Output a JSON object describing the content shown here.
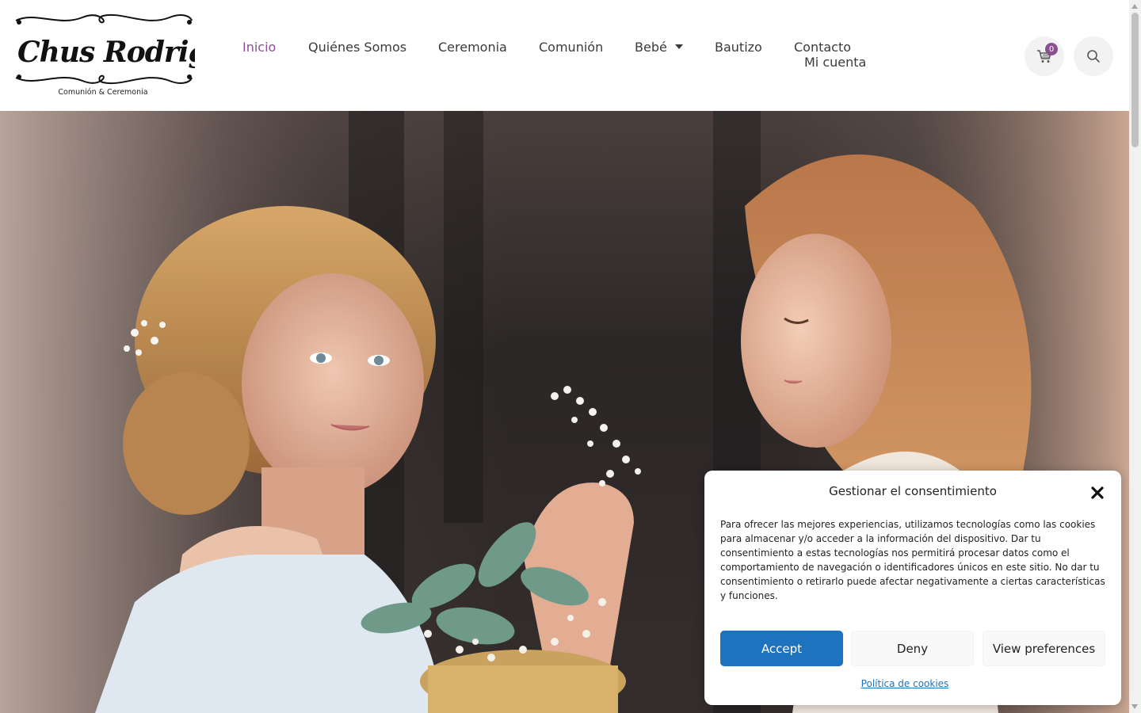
{
  "brand": {
    "logo_script": "Chus Rodriguez",
    "logo_subtitle": "Comunión & Ceremonia"
  },
  "nav": {
    "items": [
      {
        "label": "Inicio",
        "active": true
      },
      {
        "label": "Quiénes Somos"
      },
      {
        "label": "Ceremonia"
      },
      {
        "label": "Comunión"
      },
      {
        "label": "Bebé",
        "has_dropdown": true
      },
      {
        "label": "Bautizo"
      },
      {
        "label": "Contacto"
      },
      {
        "label": "Mi cuenta"
      }
    ]
  },
  "header_actions": {
    "cart_icon": "cart-icon",
    "cart_count": "0",
    "search_icon": "search-icon"
  },
  "colors": {
    "accent": "#8a4f8f",
    "button_primary": "#1e73be",
    "nav_text": "#3a3a3a"
  },
  "consent": {
    "title": "Gestionar el consentimiento",
    "body": "Para ofrecer las mejores experiencias, utilizamos tecnologías como las cookies para almacenar y/o acceder a la información del dispositivo. Dar tu consentimiento a estas tecnologías nos permitirá procesar datos como el comportamiento de navegación o identificadores únicos en este sitio. No dar tu consentimiento o retirarlo puede afectar negativamente a ciertas características y funciones.",
    "accept_label": "Accept",
    "deny_label": "Deny",
    "preferences_label": "View preferences",
    "cookie_policy_link": "Política de cookies",
    "close_icon": "close-icon"
  }
}
